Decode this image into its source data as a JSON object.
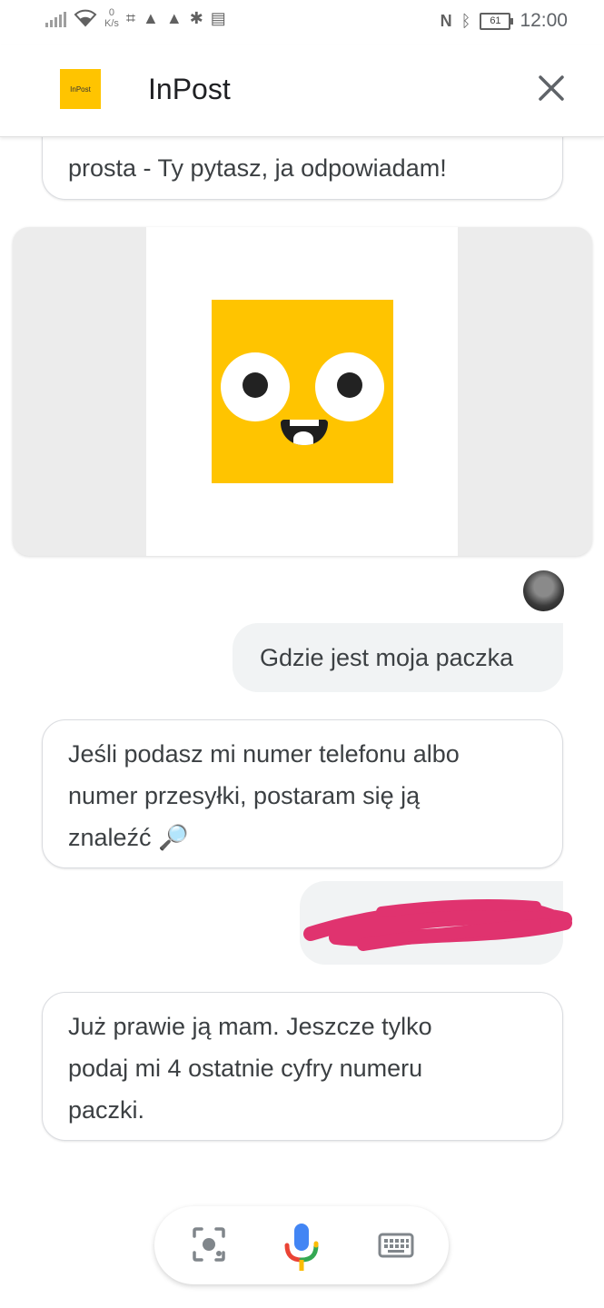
{
  "status_bar": {
    "net_speed_value": "0",
    "net_speed_unit": "K/s",
    "battery_level": "61",
    "time": "12:00"
  },
  "header": {
    "logo_text": "InPost",
    "title": "InPost"
  },
  "chat": {
    "partial_message_visible": "prosta - Ty pytasz, ja odpowiadam!",
    "user_message_1": "Gdzie jest moja paczka",
    "bot_message_1_lines": [
      "Jeśli podasz mi numer telefonu albo",
      "numer przesyłki, postaram się ją",
      "znaleźć 🔎"
    ],
    "bot_message_2_lines": [
      "Już prawie ją mam. Jeszcze tylko",
      "podaj mi 4 ostatnie cyfry numeru",
      "paczki."
    ]
  },
  "colors": {
    "brand_yellow": "#ffc400",
    "scribble": "#e0336f",
    "user_bubble": "#f1f3f4"
  },
  "icons": {
    "close": "close-icon",
    "lens": "lens-icon",
    "mic": "microphone-icon",
    "keyboard": "keyboard-icon"
  }
}
